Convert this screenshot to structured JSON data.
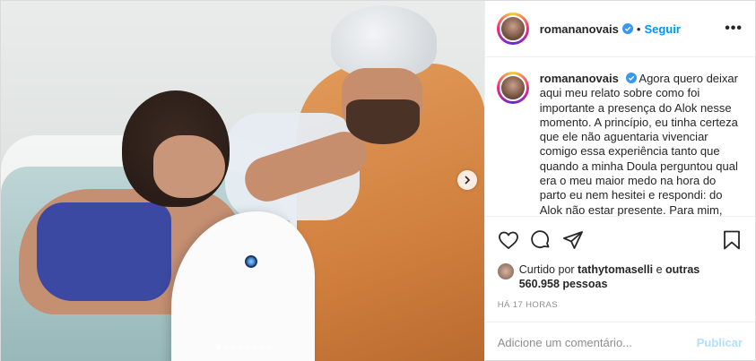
{
  "post": {
    "username": "romananovais",
    "follow_label": "Seguir",
    "more_label": "•••",
    "separator": "•",
    "caption": "Agora quero deixar aqui meu relato sobre como foi importante a presença do Alok nesse momento. A princípio, eu tinha certeza que ele não aguentaria vivenciar comigo essa experiência tanto que quando a minha Doula perguntou qual era o meu maior medo na hora do parto eu nem hesitei e respondi: do Alok não estar presente. Para mim, não sabe o Alok",
    "carousel": {
      "total": 8,
      "active_index": 0
    },
    "likes": {
      "prefix": "Curtido por",
      "user": "tathytomaselli",
      "and": "e",
      "others": "outras 560.958 pessoas"
    },
    "time_ago": "HÁ 17 HORAS",
    "comment_placeholder": "Adicione um comentário...",
    "publish_label": "Publicar"
  },
  "icons": {
    "verified": "verified-badge-icon",
    "like": "heart-icon",
    "comment": "comment-icon",
    "share": "share-icon",
    "save": "bookmark-icon",
    "next": "chevron-right-icon"
  },
  "colors": {
    "link": "#0095f6",
    "publish_disabled": "#b2dffc",
    "muted": "#8e8e8e"
  }
}
